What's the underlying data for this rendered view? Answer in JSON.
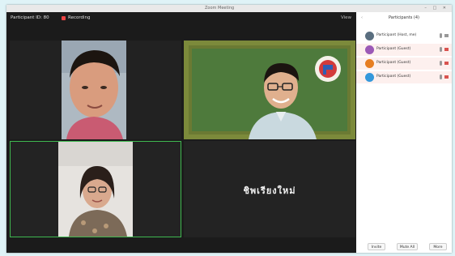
{
  "window": {
    "title": "Zoom Meeting",
    "controls": "– □ ✕"
  },
  "topbar": {
    "meeting_label": "Participant ID: 80",
    "recording_label": "Recording",
    "view_label": "View"
  },
  "tiles": [
    {
      "name": ""
    },
    {
      "name": ""
    },
    {
      "name": ""
    },
    {
      "name": "",
      "big_name": "ชิพเรียงใหม่"
    }
  ],
  "panel": {
    "title": "Participants (4)",
    "participants": [
      {
        "initials": "",
        "name": "Participant (Host, me)",
        "color": "#5a6e7f"
      },
      {
        "initials": "",
        "name": "Participant (Guest)",
        "color": "#9b59b6"
      },
      {
        "initials": "",
        "name": "Participant (Guest)",
        "color": "#e67e22"
      },
      {
        "initials": "",
        "name": "Participant (Guest)",
        "color": "#3498db"
      }
    ],
    "buttons": [
      "Invite",
      "Mute All",
      "More"
    ]
  }
}
